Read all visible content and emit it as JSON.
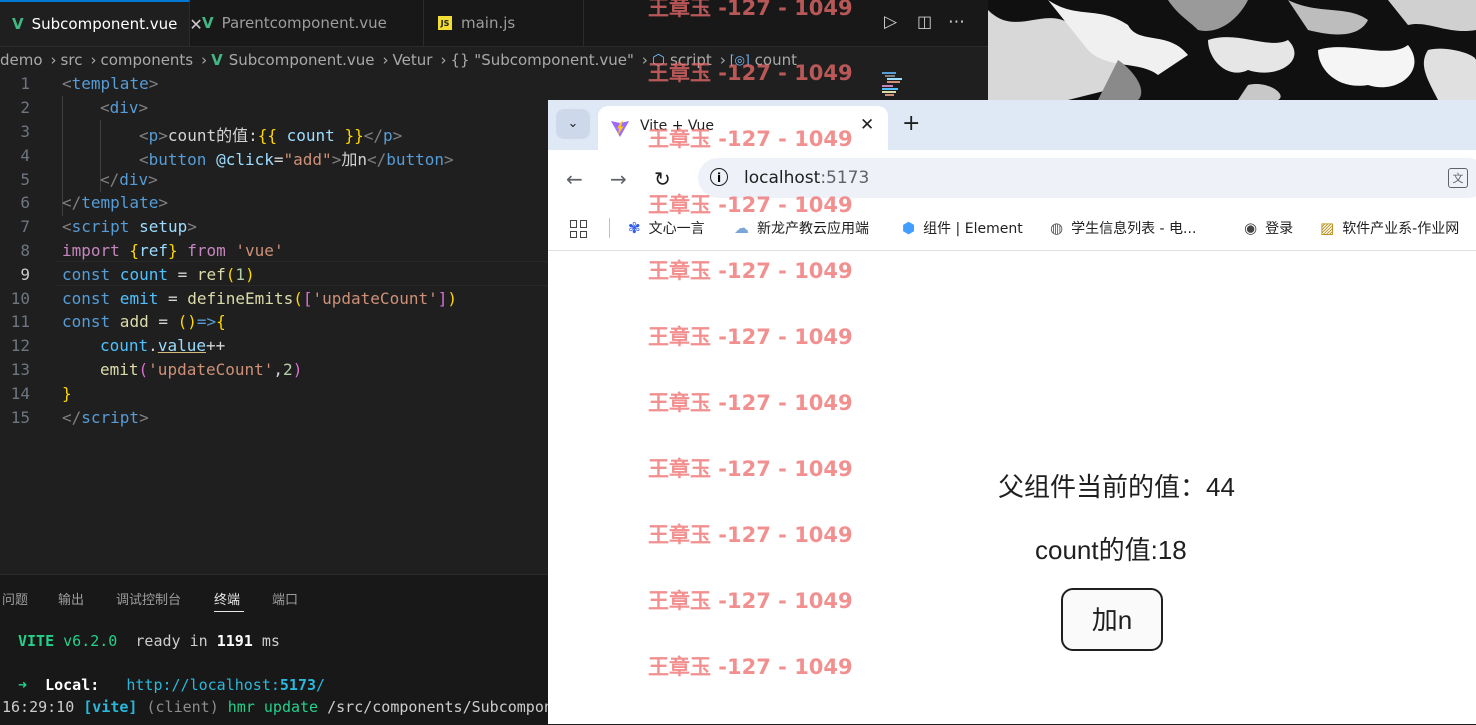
{
  "vscode": {
    "tabs": [
      {
        "label": "Subcomponent.vue",
        "type": "vue",
        "active": true
      },
      {
        "label": "Parentcomponent.vue",
        "type": "vue",
        "active": false
      },
      {
        "label": "main.js",
        "type": "js",
        "active": false
      }
    ],
    "breadcrumb": [
      "demo",
      "src",
      "components",
      "Subcomponent.vue",
      "Vetur",
      "{} \"Subcomponent.vue\"",
      "script",
      "count"
    ],
    "line_numbers": [
      "1",
      "2",
      "3",
      "4",
      "5",
      "6",
      "7",
      "8",
      "9",
      "10",
      "11",
      "12",
      "13",
      "14",
      "15"
    ],
    "current_line": "9",
    "code": {
      "l1_a": "<",
      "l1_b": "template",
      "l1_c": ">",
      "l2_a": "<",
      "l2_b": "div",
      "l2_c": ">",
      "l3_a": "<",
      "l3_b": "p",
      "l3_c": ">",
      "l3_d": "count的值:",
      "l3_e": "{{",
      "l3_f": " count ",
      "l3_g": "}}",
      "l3_h": "</",
      "l3_i": "p",
      "l3_j": ">",
      "l4_a": "<",
      "l4_b": "button",
      "l4_c": " @click",
      "l4_d": "=",
      "l4_e": "\"add\"",
      "l4_f": ">",
      "l4_g": "加n",
      "l4_h": "</",
      "l4_i": "button",
      "l4_j": ">",
      "l5_a": "</",
      "l5_b": "div",
      "l5_c": ">",
      "l6_a": "</",
      "l6_b": "template",
      "l6_c": ">",
      "l7_a": "<",
      "l7_b": "script",
      "l7_c": " setup",
      "l7_d": ">",
      "l8_a": "import",
      "l8_b": " {",
      "l8_c": "ref",
      "l8_d": "} ",
      "l8_e": "from",
      "l8_f": " ",
      "l8_g": "'vue'",
      "l9_a": "const",
      "l9_b": " count",
      "l9_c": " = ",
      "l9_d": "ref",
      "l9_e": "(",
      "l9_f": "1",
      "l9_g": ")",
      "l10_a": "const",
      "l10_b": " emit",
      "l10_c": " = ",
      "l10_d": "defineEmits",
      "l10_e": "(",
      "l10_f": "[",
      "l10_g": "'updateCount'",
      "l10_h": "]",
      "l10_i": ")",
      "l11_a": "const",
      "l11_b": " add",
      "l11_c": " = ",
      "l11_d": "()",
      "l11_e": "=>",
      "l11_f": "{",
      "l12_a": "count",
      "l12_b": ".",
      "l12_c": "value",
      "l12_d": "++",
      "l13_a": "emit",
      "l13_b": "(",
      "l13_c": "'updateCount'",
      "l13_d": ",",
      "l13_e": "2",
      "l13_f": ")",
      "l14_a": "}",
      "l15_a": "</",
      "l15_b": "script",
      "l15_c": ">"
    },
    "panel_tabs": [
      "问题",
      "输出",
      "调试控制台",
      "终端",
      "端口"
    ],
    "active_panel_tab": "终端",
    "terminal": {
      "vite": "VITE",
      "version": " v6.2.0",
      "ready": "  ready in ",
      "ms_value": "1191",
      "ms": " ms",
      "arrow": "➜",
      "local_label": "  Local:",
      "local_url_a": "http://localhost:",
      "local_url_port": "5173",
      "local_url_b": "/",
      "time": "16:29:10",
      "vite_tag": " [vite]",
      "client": " (client)",
      "hmr": " hmr update",
      "path": " /src/components/Subcompon"
    }
  },
  "chrome": {
    "tab_title": "Vite + Vue",
    "url_host": "localhost",
    "url_port": ":5173",
    "bookmarks": [
      "文心一言",
      "新龙产教云应用端",
      "组件 | Element",
      "学生信息列表 - 电...",
      "登录",
      "软件产业系-作业网"
    ],
    "page": {
      "parent_value_text": "父组件当前的值：44",
      "count_value_text": "count的值:18",
      "button_label": "加n"
    }
  },
  "watermark_text": "王章玉 -127 - 1049",
  "colors": {
    "editor_bg": "#1f1f1f",
    "vue_green": "#41b883",
    "accent_blue": "#0078d4",
    "watermark_red": "#ee6c6c"
  }
}
